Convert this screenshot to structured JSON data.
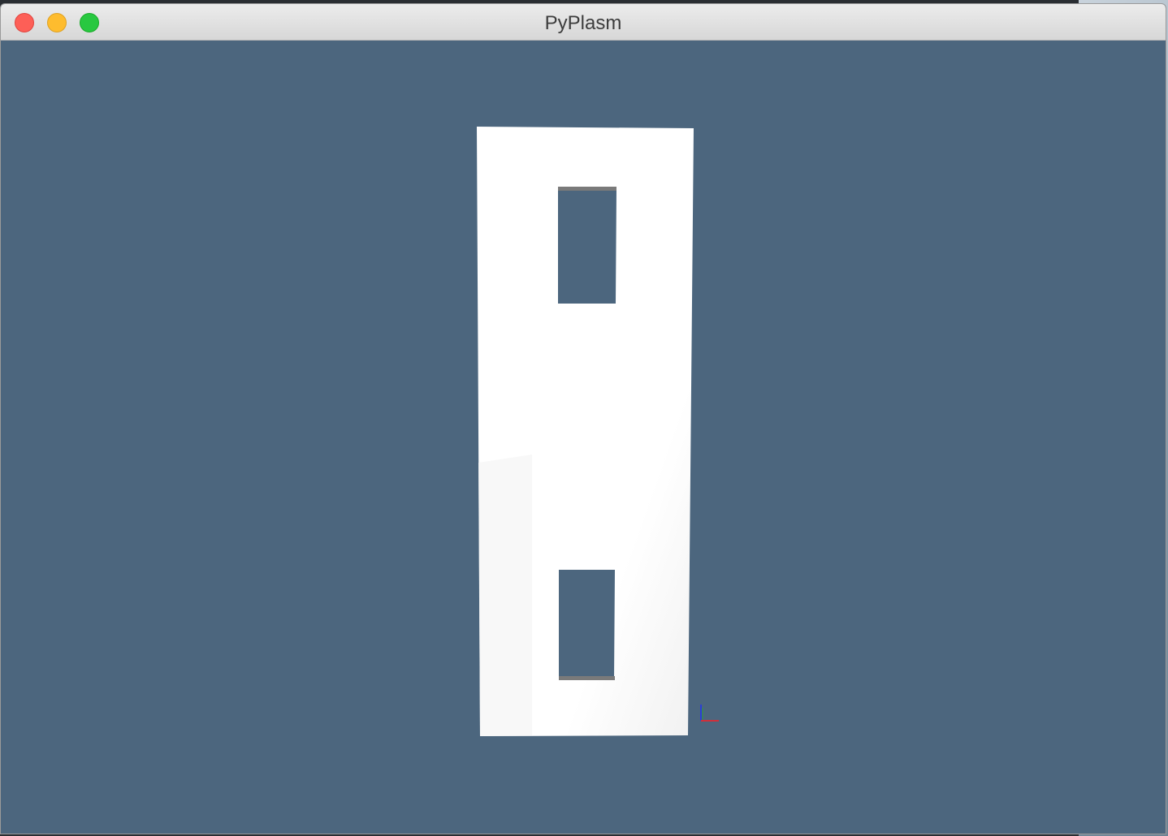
{
  "window": {
    "title": "PyPlasm"
  },
  "colors": {
    "background": "#4c667e",
    "panel": "#ffffff",
    "axis_x": "#d0303a",
    "axis_y": "#2e9a3a",
    "axis_z": "#2b3fd6"
  },
  "icons": {
    "close": "close-icon",
    "minimize": "minimize-icon",
    "zoom": "zoom-icon"
  }
}
